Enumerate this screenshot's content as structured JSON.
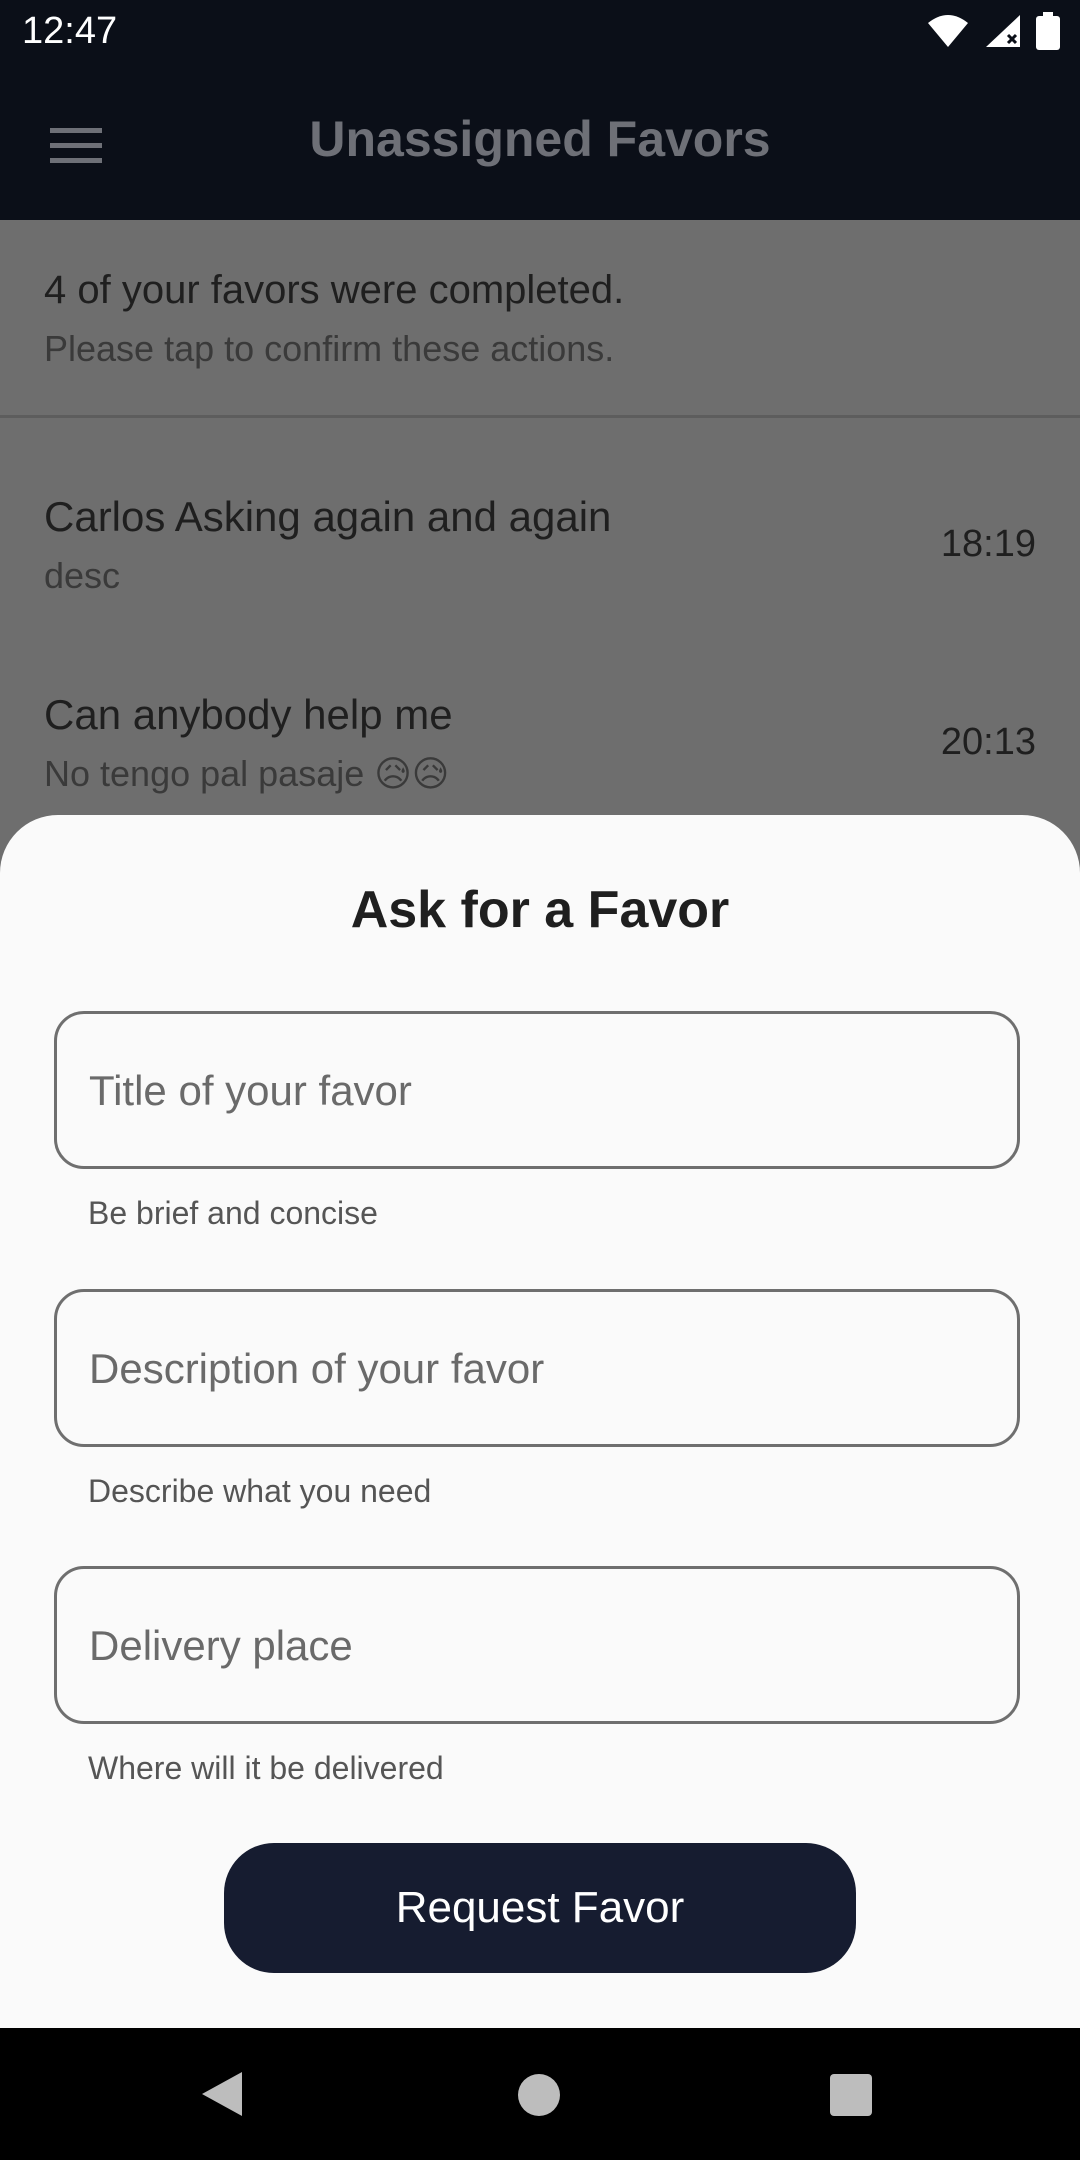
{
  "status_bar": {
    "time": "12:47",
    "icons": [
      "wifi-icon",
      "signal-icon",
      "battery-icon"
    ]
  },
  "app_bar": {
    "title": "Unassigned Favors",
    "menu_icon": "hamburger-menu-icon"
  },
  "banner": {
    "title": "4 of your favors were completed.",
    "subtitle": "Please tap to confirm these actions."
  },
  "favors": [
    {
      "title": "Carlos Asking again and again",
      "description": "desc",
      "time": "18:19"
    },
    {
      "title": "Can anybody help me",
      "description": "No tengo pal pasaje 😥😥",
      "time": "20:13"
    }
  ],
  "sheet": {
    "title": "Ask for a Favor",
    "fields": [
      {
        "placeholder": "Title of your favor",
        "helper": "Be brief and concise"
      },
      {
        "placeholder": "Description of your favor",
        "helper": "Describe what you need"
      },
      {
        "placeholder": "Delivery place",
        "helper": "Where will it be delivered"
      }
    ],
    "submit_label": "Request Favor"
  },
  "colors": {
    "app_bar_bg": "#0b0f18",
    "button_bg": "#161c30",
    "sheet_bg": "#fafafa",
    "scrim": "#6e6e6e"
  }
}
